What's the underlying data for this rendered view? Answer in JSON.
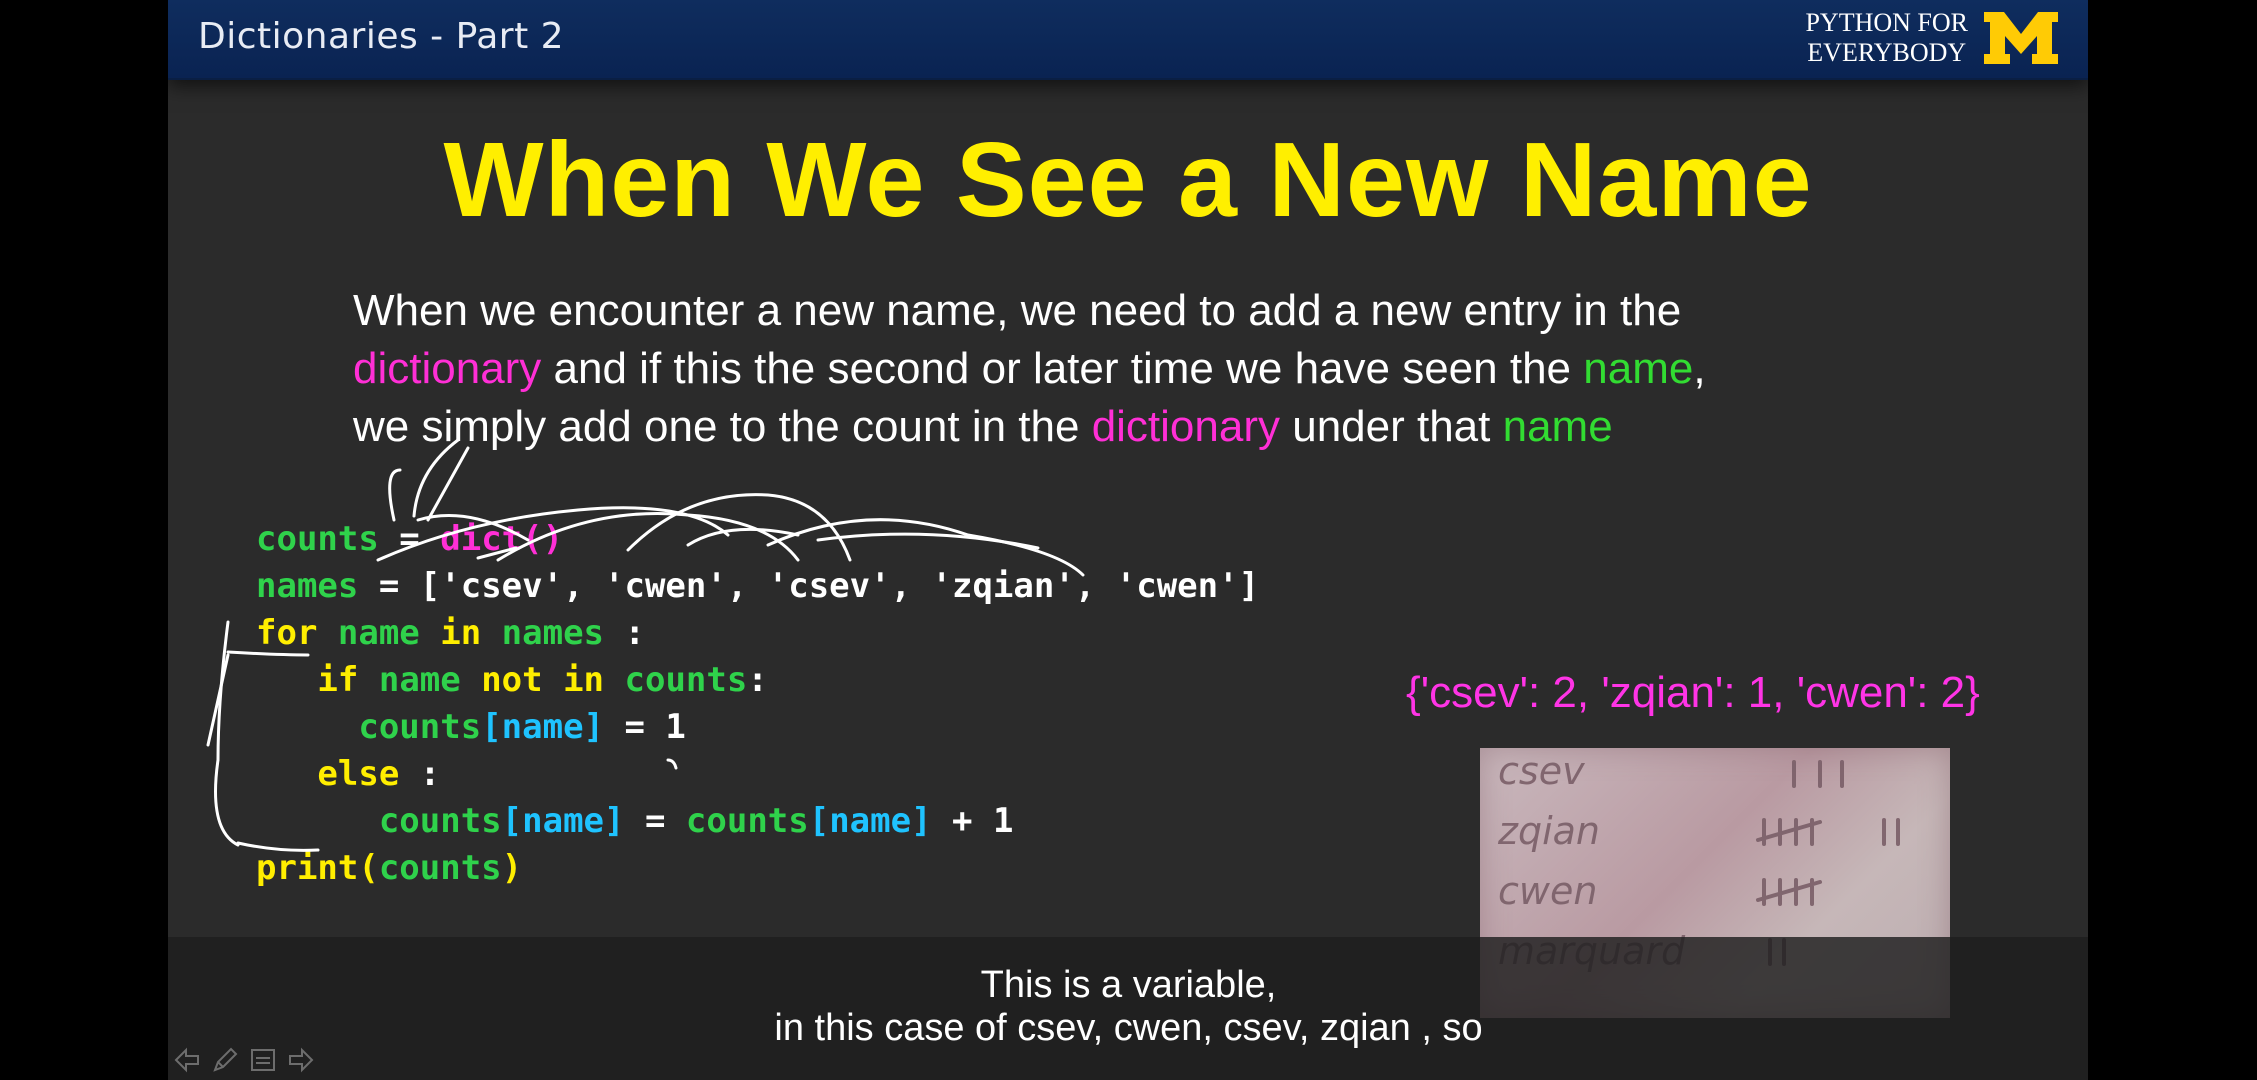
{
  "header": {
    "deck_title": "Dictionaries - Part 2",
    "brand_line1": "PYTHON FOR",
    "brand_line2": "EVERYBODY",
    "logo_icon": "university-of-michigan-block-m-logo"
  },
  "slide": {
    "heading": "When We See a New Name",
    "paragraph": {
      "p1": "When we encounter a new name, we need to add a new entry in the",
      "p2_kw": "dictionary",
      "p3": " and if this the second or later time we have seen the ",
      "p4_kw": "name",
      "p5": ",",
      "p6": "we simply add one to the count in the ",
      "p7_kw": "dictionary",
      "p8": " under that ",
      "p9_kw": "name"
    },
    "code": {
      "l1_var": "counts",
      "l1_eq": " = ",
      "l1_fn": "dict()",
      "l2_var": "names",
      "l2_eq": " = ",
      "l2_list": "['csev', 'cwen', 'csev', 'zqian', 'cwen']",
      "l3_for": "for",
      "l3_name": " name ",
      "l3_in": "in",
      "l3_names": " names ",
      "l3_colon": ":",
      "l4_if": "if",
      "l4_name": " name ",
      "l4_notin": "not in",
      "l4_counts": " counts",
      "l4_colon": ":",
      "l5_counts": "counts",
      "l5_idx": "[name]",
      "l5_rest": " = 1",
      "l6_else": "else",
      "l6_colon": " :",
      "l7_counts": "counts",
      "l7_idx": "[name]",
      "l7_eq": " = ",
      "l7_counts2": "counts",
      "l7_idx2": "[name]",
      "l7_rest": " + 1",
      "l8_print": "print(",
      "l8_counts": "counts",
      "l8_close": ")"
    },
    "result_output": "{'csev': 2, 'zqian': 1, 'cwen': 2}",
    "photo_tally": [
      "csev",
      "zqian",
      "cwen",
      "marquard"
    ]
  },
  "captions": {
    "line1": "This is a variable,",
    "line2": "in this case of csev, cwen, csev, zqian , so"
  },
  "nav": {
    "icons": [
      "prev-arrow-icon",
      "pen-icon",
      "menu-icon",
      "next-arrow-icon"
    ]
  },
  "colors": {
    "heading": "#ffef00",
    "keyword_dictionary": "#ff2fd6",
    "keyword_name": "#32dc32",
    "code_cyan": "#1fc3ff",
    "header_bg": "#0f2d5e"
  }
}
